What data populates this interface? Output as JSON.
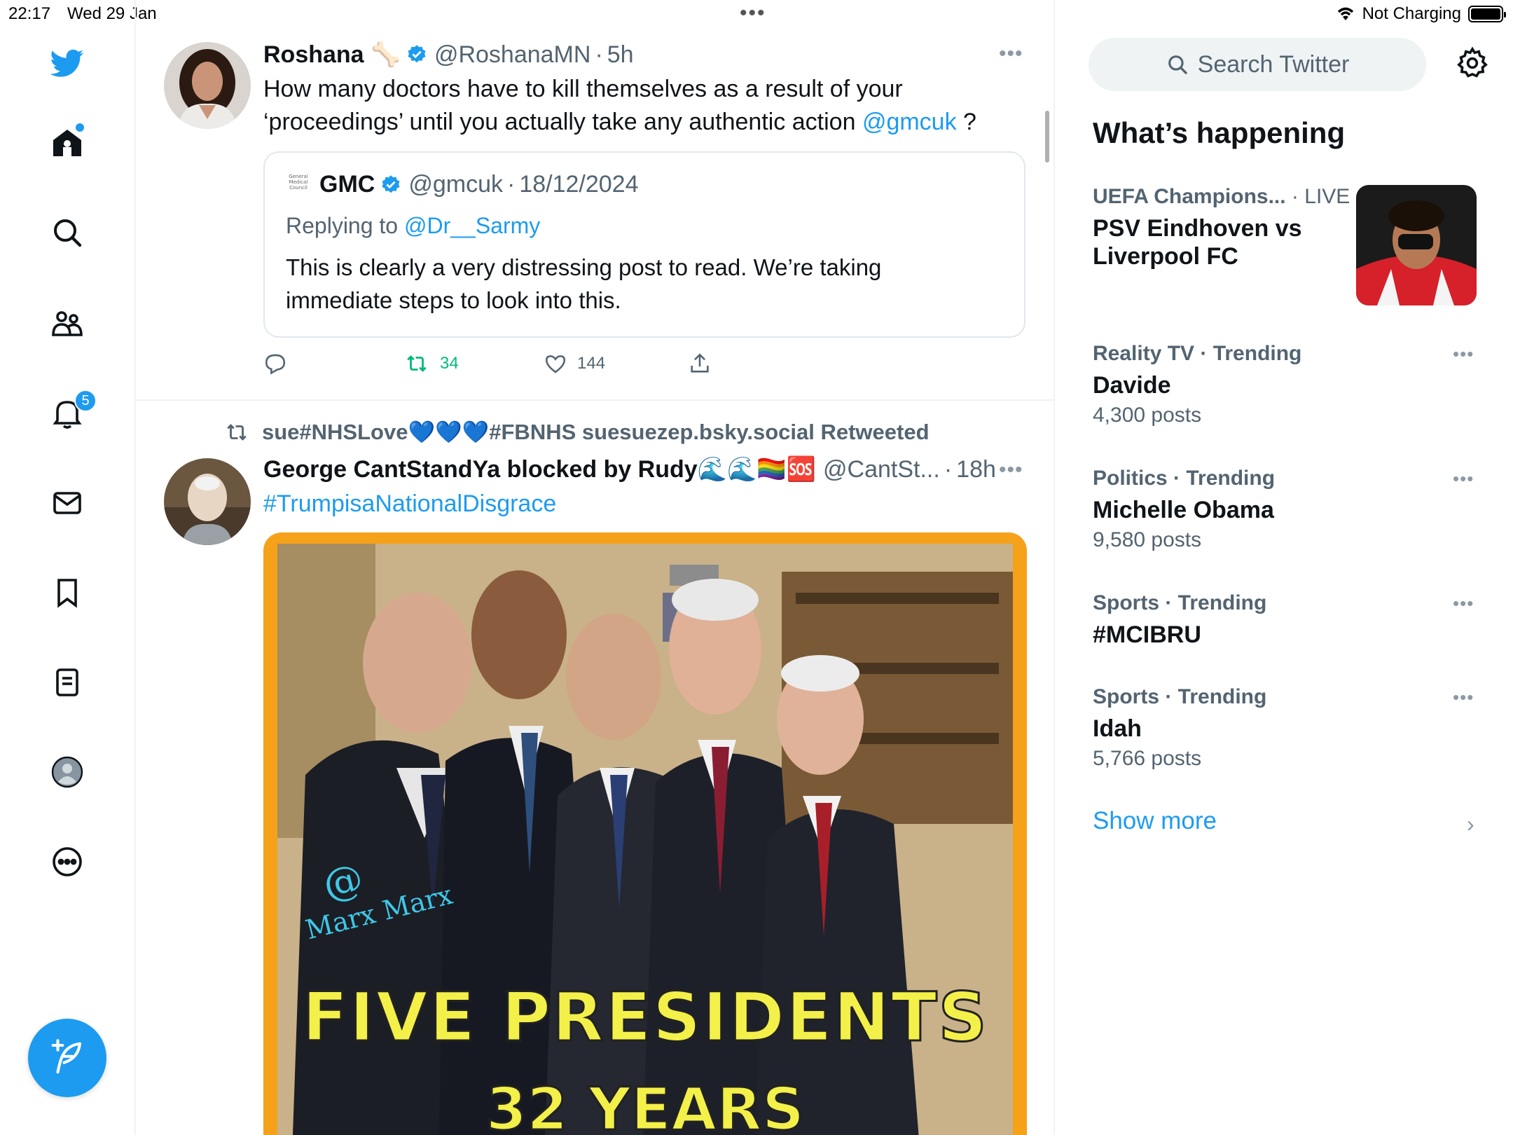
{
  "status_bar": {
    "time": "22:17",
    "date": "Wed 29 Jan",
    "charging": "Not Charging"
  },
  "nav": {
    "items": [
      "home-icon",
      "search-icon",
      "communities-icon",
      "notifications-icon",
      "messages-icon",
      "bookmarks-icon",
      "lists-icon",
      "profile-icon",
      "more-icon"
    ],
    "notification_count": "5",
    "compose_icon": "compose-icon"
  },
  "tweet1": {
    "name": "Roshana",
    "name_emoji": "🦴",
    "handle": "@RoshanaMN",
    "sep": "·",
    "time": "5h",
    "text_line1": "How many doctors have to kill themselves as a result of your",
    "text_line2_a": "‘proceedings’ until you actually take any authentic action ",
    "text_line2_link": "@gmcuk",
    "text_line2_b": " ?",
    "quote": {
      "logo_text": "General Medical Council",
      "name": "GMC",
      "handle": "@gmcuk",
      "sep": "·",
      "date": "18/12/2024",
      "replying_to": "Replying to ",
      "replying_handle": "@Dr__Sarmy",
      "text_line1": "This is clearly a very distressing post to read. We’re taking",
      "text_line2": "immediate steps to look into this."
    },
    "retweets": "34",
    "likes": "144"
  },
  "tweet2": {
    "retweeted_by": "sue#NHSLove💙💙💙#FBNHS suesuezep.bsky.social Retweeted",
    "name": "George CantStandYa blocked by Rudy🌊🌊🏳️‍🌈🆘",
    "handle": "@CantSt...",
    "sep": "·",
    "time": "18h",
    "text": "#TrumpisaNationalDisgrace",
    "media": {
      "watermark_at": "@",
      "watermark": "Marx Marx",
      "caption_line1": "FIVE PRESIDENTS",
      "caption_line2": "32 YEARS"
    }
  },
  "sidebar": {
    "search_placeholder": "Search Twitter",
    "whats_happening": "What’s happening",
    "trends": [
      {
        "meta": "UEFA Champions...",
        "meta2": " · LIVE",
        "name": "PSV Eindhoven vs Liverpool FC",
        "posts": ""
      },
      {
        "meta": "Reality TV · Trending",
        "meta2": "",
        "name": "Davide",
        "posts": "4,300 posts"
      },
      {
        "meta": "Politics · Trending",
        "meta2": "",
        "name": "Michelle Obama",
        "posts": "9,580 posts"
      },
      {
        "meta": "Sports · Trending",
        "meta2": "",
        "name": "#MCIBRU",
        "posts": ""
      },
      {
        "meta": "Sports · Trending",
        "meta2": "",
        "name": "Idah",
        "posts": "5,766 posts"
      }
    ],
    "show_more": "Show more"
  },
  "colors": {
    "accent": "#1d9bf0",
    "retweet_green": "#00ba7c",
    "secondary_text": "#536471"
  }
}
